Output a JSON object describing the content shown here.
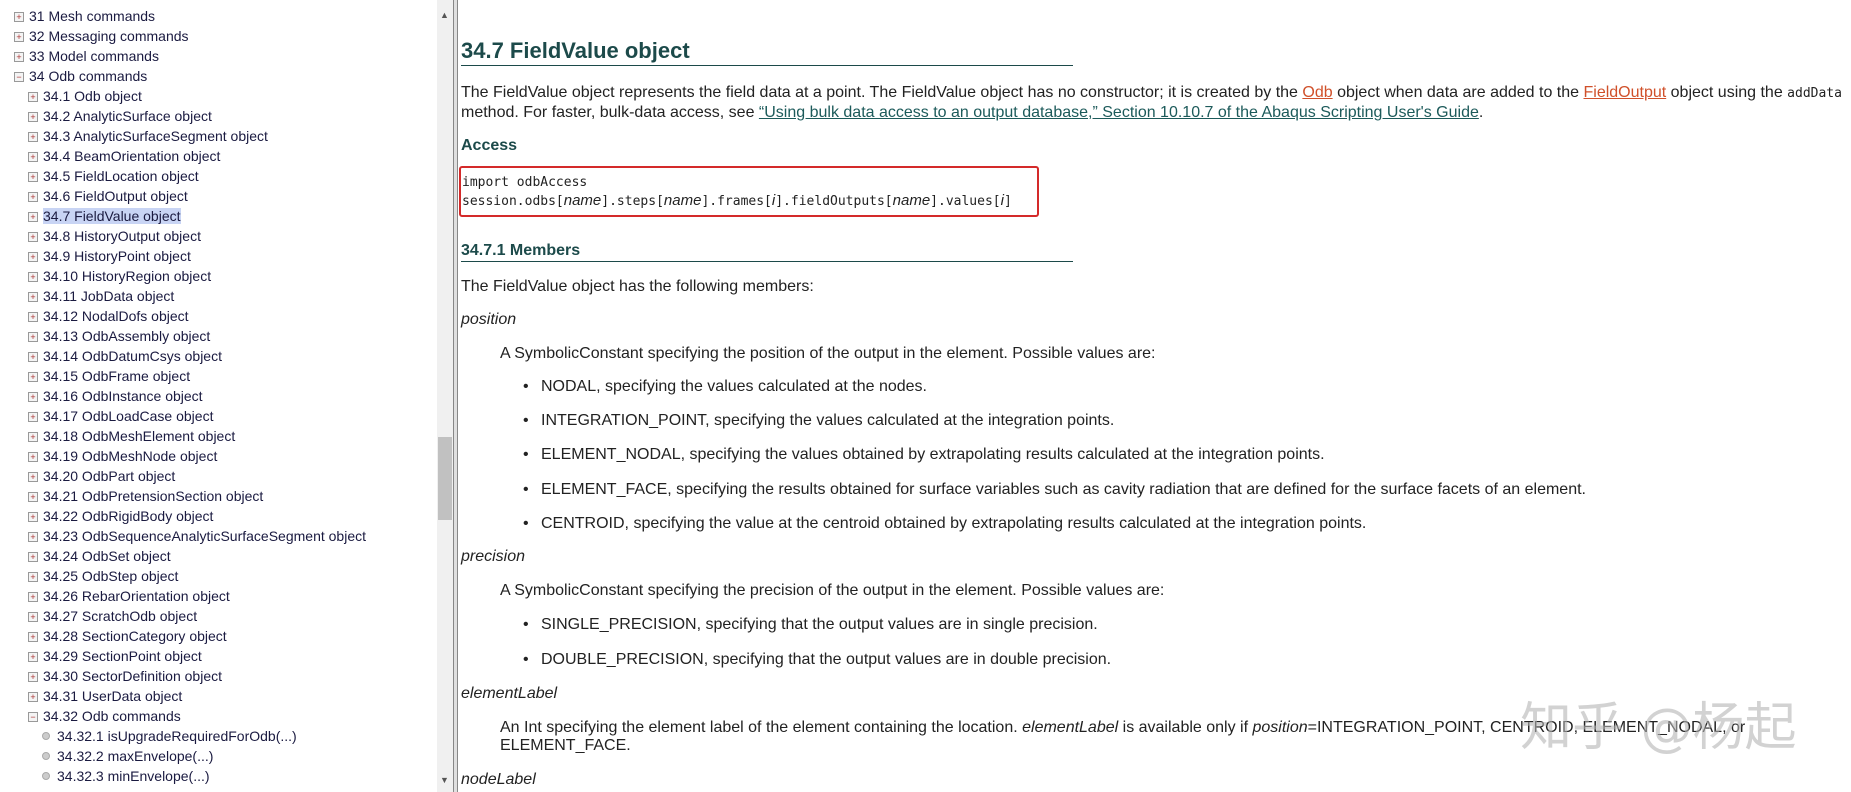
{
  "sidebar": {
    "items": [
      {
        "label": "31 Mesh commands",
        "level": 0,
        "icon": "plus-box"
      },
      {
        "label": "32 Messaging commands",
        "level": 0,
        "icon": "plus-box"
      },
      {
        "label": "33 Model commands",
        "level": 0,
        "icon": "plus-box"
      },
      {
        "label": "34 Odb commands",
        "level": 0,
        "icon": "minus-box"
      },
      {
        "label": "34.1 Odb object",
        "level": 1,
        "icon": "plus-box"
      },
      {
        "label": "34.2 AnalyticSurface object",
        "level": 1,
        "icon": "plus-box"
      },
      {
        "label": "34.3 AnalyticSurfaceSegment object",
        "level": 1,
        "icon": "plus-box"
      },
      {
        "label": "34.4 BeamOrientation object",
        "level": 1,
        "icon": "plus-box"
      },
      {
        "label": "34.5 FieldLocation object",
        "level": 1,
        "icon": "plus-box"
      },
      {
        "label": "34.6 FieldOutput object",
        "level": 1,
        "icon": "plus-box"
      },
      {
        "label": "34.7 FieldValue object",
        "level": 1,
        "icon": "plus-box",
        "selected": true
      },
      {
        "label": "34.8 HistoryOutput object",
        "level": 1,
        "icon": "plus-box"
      },
      {
        "label": "34.9 HistoryPoint object",
        "level": 1,
        "icon": "plus-box"
      },
      {
        "label": "34.10 HistoryRegion object",
        "level": 1,
        "icon": "plus-box"
      },
      {
        "label": "34.11 JobData object",
        "level": 1,
        "icon": "plus-box"
      },
      {
        "label": "34.12 NodalDofs object",
        "level": 1,
        "icon": "plus-box"
      },
      {
        "label": "34.13 OdbAssembly object",
        "level": 1,
        "icon": "plus-box"
      },
      {
        "label": "34.14 OdbDatumCsys object",
        "level": 1,
        "icon": "plus-box"
      },
      {
        "label": "34.15 OdbFrame object",
        "level": 1,
        "icon": "plus-box"
      },
      {
        "label": "34.16 OdbInstance object",
        "level": 1,
        "icon": "plus-box"
      },
      {
        "label": "34.17 OdbLoadCase object",
        "level": 1,
        "icon": "plus-box"
      },
      {
        "label": "34.18 OdbMeshElement object",
        "level": 1,
        "icon": "plus-box"
      },
      {
        "label": "34.19 OdbMeshNode object",
        "level": 1,
        "icon": "plus-box"
      },
      {
        "label": "34.20 OdbPart object",
        "level": 1,
        "icon": "plus-box"
      },
      {
        "label": "34.21 OdbPretensionSection object",
        "level": 1,
        "icon": "plus-box"
      },
      {
        "label": "34.22 OdbRigidBody object",
        "level": 1,
        "icon": "plus-box"
      },
      {
        "label": "34.23 OdbSequenceAnalyticSurfaceSegment object",
        "level": 1,
        "icon": "plus-box"
      },
      {
        "label": "34.24 OdbSet object",
        "level": 1,
        "icon": "plus-box"
      },
      {
        "label": "34.25 OdbStep object",
        "level": 1,
        "icon": "plus-box"
      },
      {
        "label": "34.26 RebarOrientation object",
        "level": 1,
        "icon": "plus-box"
      },
      {
        "label": "34.27 ScratchOdb object",
        "level": 1,
        "icon": "plus-box"
      },
      {
        "label": "34.28 SectionCategory object",
        "level": 1,
        "icon": "plus-box"
      },
      {
        "label": "34.29 SectionPoint object",
        "level": 1,
        "icon": "plus-box"
      },
      {
        "label": "34.30 SectorDefinition object",
        "level": 1,
        "icon": "plus-box"
      },
      {
        "label": "34.31 UserData object",
        "level": 1,
        "icon": "plus-box"
      },
      {
        "label": "34.32 Odb commands",
        "level": 1,
        "icon": "minus-box"
      },
      {
        "label": "34.32.1 isUpgradeRequiredForOdb(...)",
        "level": 2,
        "icon": "dot"
      },
      {
        "label": "34.32.2 maxEnvelope(...)",
        "level": 2,
        "icon": "dot"
      },
      {
        "label": "34.32.3 minEnvelope(...)",
        "level": 2,
        "icon": "dot"
      }
    ]
  },
  "main": {
    "title": "34.7 FieldValue object",
    "intro": {
      "p1": "The FieldValue object represents the field data at a point. The FieldValue object has no constructor; it is created by the ",
      "odb_link": "Odb",
      "p2": " object when data are added to the ",
      "fieldoutput_link": "FieldOutput",
      "p3": " object using the ",
      "code": "addData",
      "p4": "method. For faster, bulk-data access, see ",
      "guide_link": "“Using bulk data access to an output database,” Section 10.10.7 of the Abaqus Scripting User's Guide",
      "p5": "."
    },
    "access_heading": "Access",
    "code": {
      "line1": "import odbAccess",
      "l2a": "session.odbs[",
      "name": "name",
      "l2b": "].steps[",
      "l2c": "].frames[",
      "i": "i",
      "l2d": "].fieldOutputs[",
      "l2e": "].values[",
      " close": "]"
    },
    "members_heading": "34.7.1  Members",
    "members_intro": "The FieldValue object has the following members:",
    "position": {
      "name": "position",
      "desc": "A SymbolicConstant specifying the position of the output in the element. Possible values are:",
      "bullets": [
        "NODAL, specifying the values calculated at the nodes.",
        "INTEGRATION_POINT, specifying the values calculated at the integration points.",
        "ELEMENT_NODAL, specifying the values obtained by extrapolating results calculated at the integration points.",
        "ELEMENT_FACE, specifying the results obtained for surface variables such as cavity radiation that are defined for the surface facets of an element.",
        "CENTROID, specifying the value at the centroid obtained by extrapolating results calculated at the integration points."
      ]
    },
    "precision": {
      "name": "precision",
      "desc": "A SymbolicConstant specifying the precision of the output in the element. Possible values are:",
      "bullets": [
        "SINGLE_PRECISION, specifying that the output values are in single precision.",
        "DOUBLE_PRECISION, specifying that the output values are in double precision."
      ]
    },
    "elementLabel": {
      "name": "elementLabel",
      "d1": "An Int specifying the element label of the element containing the location. ",
      "d2": "elementLabel",
      "d3": " is available only if ",
      "d4": "position",
      "d5": "=INTEGRATION_POINT, CENTROID, ELEMENT_NODAL, or",
      "d6": "ELEMENT_FACE."
    },
    "nodeLabel": {
      "name": "nodeLabel"
    }
  },
  "watermark": "知乎 @杨起",
  "colors": {
    "heading": "#1c4a4a",
    "link_orange": "#d0502a",
    "highlight_box": "#d42a2a",
    "selection": "#c8d4f4"
  }
}
